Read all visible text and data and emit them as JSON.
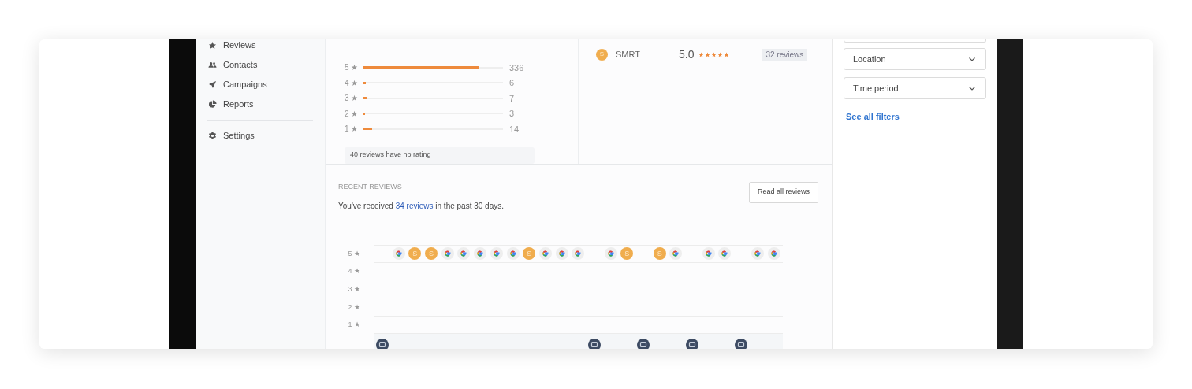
{
  "sidebar": {
    "items": [
      {
        "kind": "star",
        "label": "Reviews"
      },
      {
        "kind": "people",
        "label": "Contacts"
      },
      {
        "kind": "send",
        "label": "Campaigns"
      },
      {
        "kind": "pie",
        "label": "Reports"
      }
    ],
    "footer_items": [
      {
        "kind": "gear",
        "label": "Settings"
      }
    ]
  },
  "rating_breakdown": {
    "rows": [
      {
        "label": "5 ★",
        "level": 0.83,
        "count": "336"
      },
      {
        "label": "4 ★",
        "level": 0.015,
        "count": "6"
      },
      {
        "label": "3 ★",
        "level": 0.02,
        "count": "7"
      },
      {
        "label": "2 ★",
        "level": 0.01,
        "count": "3"
      },
      {
        "label": "1 ★",
        "level": 0.06,
        "count": "14"
      }
    ],
    "note": "40 reviews have no rating"
  },
  "sources": [
    {
      "initial": "S",
      "name": "SMRT",
      "score": "5.0",
      "stars": 5,
      "count": "32 reviews"
    }
  ],
  "filters": {
    "dropdowns": [
      {
        "label": "Location"
      },
      {
        "label": "Time period"
      }
    ],
    "link": "See all filters"
  },
  "recent_reviews": {
    "heading": "RECENT REVIEWS",
    "summary_before": "You've received ",
    "summary_link": "34 reviews",
    "summary_after": " in the past 30 days.",
    "button": "Read all reviews",
    "rows": [
      {
        "label": "5 ★",
        "markers": [
          {
            "kind": "gap"
          },
          {
            "kind": "google"
          },
          {
            "kind": "smrt",
            "letter": "S"
          },
          {
            "kind": "smrt",
            "letter": "S"
          },
          {
            "kind": "google"
          },
          {
            "kind": "google"
          },
          {
            "kind": "google"
          },
          {
            "kind": "google"
          },
          {
            "kind": "google"
          },
          {
            "kind": "smrt",
            "letter": "S"
          },
          {
            "kind": "google"
          },
          {
            "kind": "google"
          },
          {
            "kind": "google"
          },
          {
            "kind": "gap"
          },
          {
            "kind": "google"
          },
          {
            "kind": "smrt",
            "letter": "S"
          },
          {
            "kind": "gap"
          },
          {
            "kind": "smrt",
            "letter": "S"
          },
          {
            "kind": "google"
          },
          {
            "kind": "gap"
          },
          {
            "kind": "google"
          },
          {
            "kind": "google"
          },
          {
            "kind": "gap"
          },
          {
            "kind": "google"
          },
          {
            "kind": "google"
          }
        ]
      },
      {
        "label": "4 ★",
        "markers": []
      },
      {
        "label": "3 ★",
        "markers": []
      },
      {
        "label": "2 ★",
        "markers": []
      },
      {
        "label": "1 ★",
        "markers": []
      },
      {
        "markers": [
          {
            "kind": "message"
          },
          {
            "kind": "gap"
          },
          {
            "kind": "gap"
          },
          {
            "kind": "gap"
          },
          {
            "kind": "gap"
          },
          {
            "kind": "gap"
          },
          {
            "kind": "gap"
          },
          {
            "kind": "gap"
          },
          {
            "kind": "gap"
          },
          {
            "kind": "gap"
          },
          {
            "kind": "gap"
          },
          {
            "kind": "gap"
          },
          {
            "kind": "gap"
          },
          {
            "kind": "message"
          },
          {
            "kind": "gap"
          },
          {
            "kind": "gap"
          },
          {
            "kind": "message"
          },
          {
            "kind": "gap"
          },
          {
            "kind": "gap"
          },
          {
            "kind": "message"
          },
          {
            "kind": "gap"
          },
          {
            "kind": "gap"
          },
          {
            "kind": "message"
          }
        ]
      }
    ]
  }
}
